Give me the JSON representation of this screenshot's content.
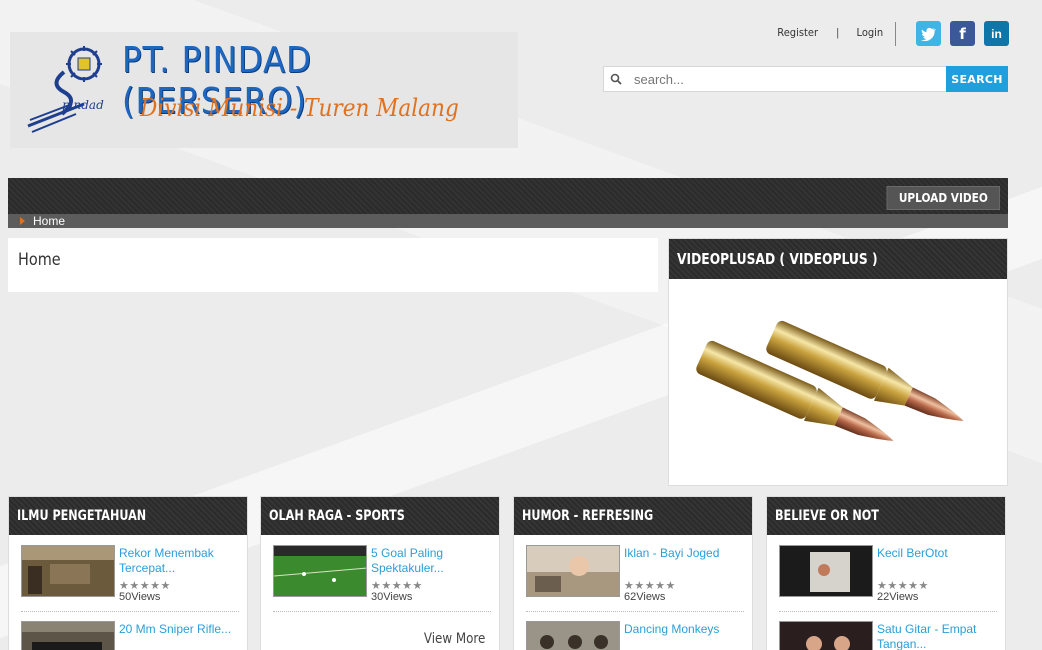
{
  "header": {
    "logo_title": "PT. PINDAD (PERSERO)",
    "logo_subtitle": "Divisi Munisi - Turen Malang",
    "logo_mark_text": "pindad",
    "register_label": "Register",
    "separator": "|",
    "login_label": "Login",
    "social": {
      "twitter": "t",
      "facebook": "f",
      "linkedin": "in"
    },
    "search": {
      "placeholder": "search...",
      "button_label": "SEARCH"
    }
  },
  "nav": {
    "upload_label": "UPLOAD VIDEO",
    "breadcrumb": "Home"
  },
  "main": {
    "page_title": "Home"
  },
  "sidebar": {
    "title": "VIDEOPLUSAD ( VIDEOPLUS )"
  },
  "categories": [
    {
      "title": "ILMU PENGETAHUAN",
      "items": [
        {
          "title": "Rekor Menembak Tercepat...",
          "stars": "★★★★★",
          "views": "50Views"
        },
        {
          "title": "20 Mm Sniper Rifle...",
          "stars": "",
          "views": ""
        }
      ],
      "view_more": ""
    },
    {
      "title": "OLAH RAGA - SPORTS",
      "items": [
        {
          "title": "5 Goal Paling Spektakuler...",
          "stars": "★★★★★",
          "views": "30Views"
        }
      ],
      "view_more": "View More"
    },
    {
      "title": "HUMOR - REFRESING",
      "items": [
        {
          "title": "Iklan - Bayi Joged",
          "stars": "★★★★★",
          "views": "62Views"
        },
        {
          "title": "Dancing Monkeys",
          "stars": "",
          "views": ""
        }
      ],
      "view_more": ""
    },
    {
      "title": "BELIEVE OR NOT",
      "items": [
        {
          "title": "Kecil BerOtot",
          "stars": "★★★★★",
          "views": "22Views"
        },
        {
          "title": "Satu Gitar - Empat Tangan...",
          "stars": "",
          "views": ""
        }
      ],
      "view_more": ""
    }
  ],
  "colors": {
    "accent": "#1ea0dc",
    "brand_blue": "#1e67c0",
    "brand_orange": "#e2711d",
    "dark_bar": "#2f2f2f"
  }
}
